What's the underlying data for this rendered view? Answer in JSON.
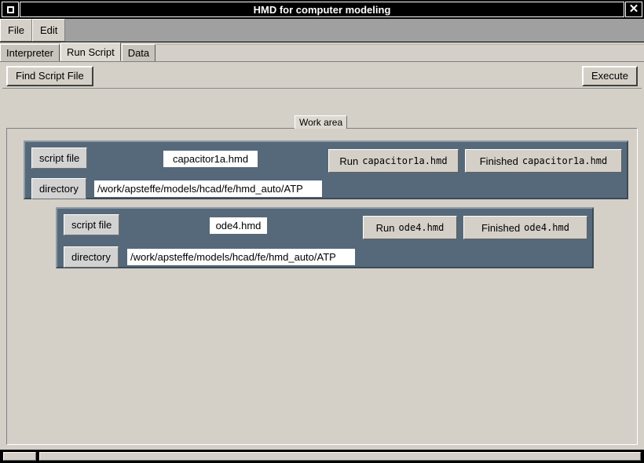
{
  "window": {
    "title": "HMD for computer modeling",
    "system_menu_icon": "window-restore-icon",
    "close_label": "✕"
  },
  "menubar": {
    "items": [
      {
        "label": "File"
      },
      {
        "label": "Edit"
      }
    ]
  },
  "tabs": {
    "items": [
      {
        "label": "Interpreter",
        "active": false
      },
      {
        "label": "Run Script",
        "active": true
      },
      {
        "label": "Data",
        "active": false
      }
    ]
  },
  "toolbar": {
    "find_script_label": "Find Script File",
    "execute_label": "Execute"
  },
  "workarea": {
    "label": "Work area",
    "panels": [
      {
        "script_file_label": "script file",
        "script_file_value": "capacitor1a.hmd",
        "directory_label": "directory",
        "directory_value": "/work/apsteffe/models/hcad/fe/hmd_auto/ATP",
        "run_button_lead": "Run",
        "run_button_file": "capacitor1a.hmd",
        "status_button_lead": "Finished",
        "status_button_file": "capacitor1a.hmd"
      },
      {
        "script_file_label": "script file",
        "script_file_value": "ode4.hmd",
        "directory_label": "directory",
        "directory_value": "/work/apsteffe/models/hcad/fe/hmd_auto/ATP",
        "run_button_lead": "Run",
        "run_button_file": "ode4.hmd",
        "status_button_lead": "Finished",
        "status_button_file": "ode4.hmd"
      }
    ]
  },
  "colors": {
    "titlebar_bg": "#000000",
    "window_face": "#d4d0c8",
    "menubar_bg": "#a0a0a0",
    "panel_bg": "#56697a",
    "field_label_bg": "#d2d2d2",
    "value_bg": "#ffffff"
  }
}
